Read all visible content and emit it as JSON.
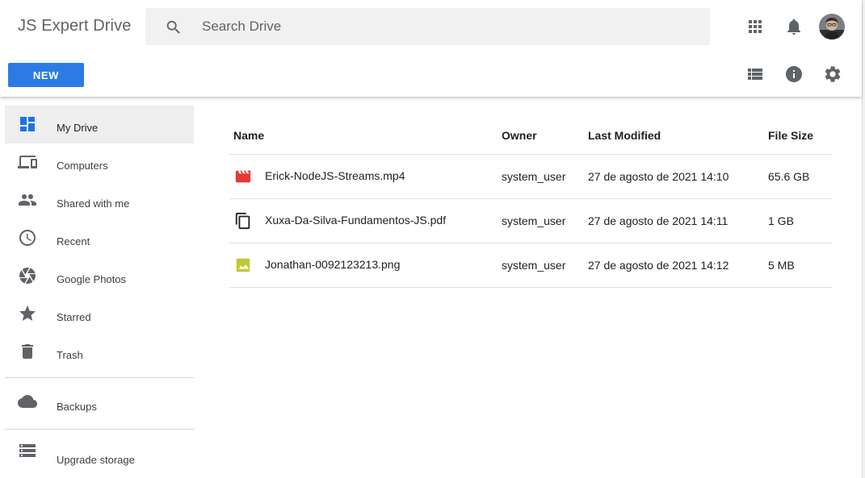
{
  "app": {
    "title": "JS Expert Drive"
  },
  "search": {
    "placeholder": "Search Drive",
    "value": ""
  },
  "header_icons": [
    "apps-grid-icon",
    "notifications-bell-icon",
    "user-avatar"
  ],
  "toolbar": {
    "new_label": "NEW",
    "icons": [
      "list-view-icon",
      "info-icon",
      "settings-gear-icon"
    ]
  },
  "sidebar": {
    "items": [
      {
        "label": "My Drive",
        "icon": "my-drive-icon",
        "active": true
      },
      {
        "label": "Computers",
        "icon": "computers-icon",
        "active": false
      },
      {
        "label": "Shared with me",
        "icon": "shared-people-icon",
        "active": false
      },
      {
        "label": "Recent",
        "icon": "clock-icon",
        "active": false
      },
      {
        "label": "Google Photos",
        "icon": "photos-pinwheel-icon",
        "active": false
      },
      {
        "label": "Starred",
        "icon": "star-icon",
        "active": false
      },
      {
        "label": "Trash",
        "icon": "trash-icon",
        "active": false
      },
      {
        "label": "Backups",
        "icon": "cloud-icon",
        "active": false
      },
      {
        "label": "Upgrade storage",
        "icon": "storage-icon",
        "active": false
      }
    ]
  },
  "table": {
    "headers": {
      "name": "Name",
      "owner": "Owner",
      "modified": "Last Modified",
      "size": "File Size"
    },
    "rows": [
      {
        "name": "Erick-NodeJS-Streams.mp4",
        "owner": "system_user",
        "modified": "27 de agosto de 2021 14:10",
        "size": "65.6 GB",
        "icon": "movie-icon"
      },
      {
        "name": "Xuxa-Da-Silva-Fundamentos-JS.pdf",
        "owner": "system_user",
        "modified": "27 de agosto de 2021 14:11",
        "size": "1 GB",
        "icon": "copy-document-icon"
      },
      {
        "name": "Jonathan-0092123213.png",
        "owner": "system_user",
        "modified": "27 de agosto de 2021 14:12",
        "size": "5 MB",
        "icon": "image-icon"
      }
    ]
  },
  "colors": {
    "accent": "#2c7be5",
    "icon_gray": "#5f6368",
    "active_nav": "#1a73e8",
    "movie_red": "#e53935",
    "image_yellow": "#c0ca33"
  }
}
